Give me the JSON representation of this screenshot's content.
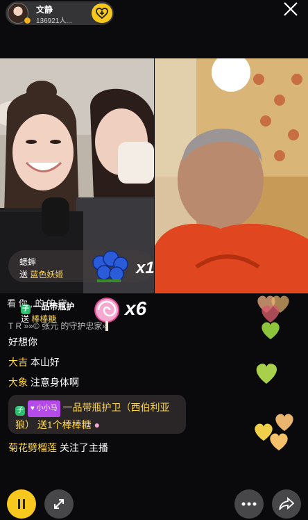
{
  "host": {
    "name": "文静",
    "fans": "136921人..."
  },
  "gift_banner": {
    "user": "蟋蟀",
    "send_prefix": "送",
    "gift": "蓝色妖姬",
    "multiplier": "x1"
  },
  "gift_banner2": {
    "user": "一品带瓶护",
    "send_prefix": "送",
    "gift": "棒棒糖",
    "multiplier": "x6",
    "overlay_text": "看    你 ,    的      的 守   ",
    "level": "子"
  },
  "marquee": {
    "left": "T  R",
    "text": "»»© 张元 的守护忠家»"
  },
  "chat": [
    {
      "user": "",
      "text": "好想你"
    },
    {
      "user": "大吉",
      "text": "本山好"
    },
    {
      "user": "大象",
      "text": "注意身体啊"
    }
  ],
  "gift_message": {
    "level": "子",
    "tag": "小小马",
    "text": "一品带瓶护卫（西伯利亚狼）",
    "send": "送1个棒棒糖"
  },
  "follow_message": {
    "user": "菊花劈榴莲",
    "text": "关注了主播"
  },
  "colors": {
    "accent": "#f8c81e",
    "gift_text": "#ffd84a",
    "tag": "#b54be8"
  }
}
